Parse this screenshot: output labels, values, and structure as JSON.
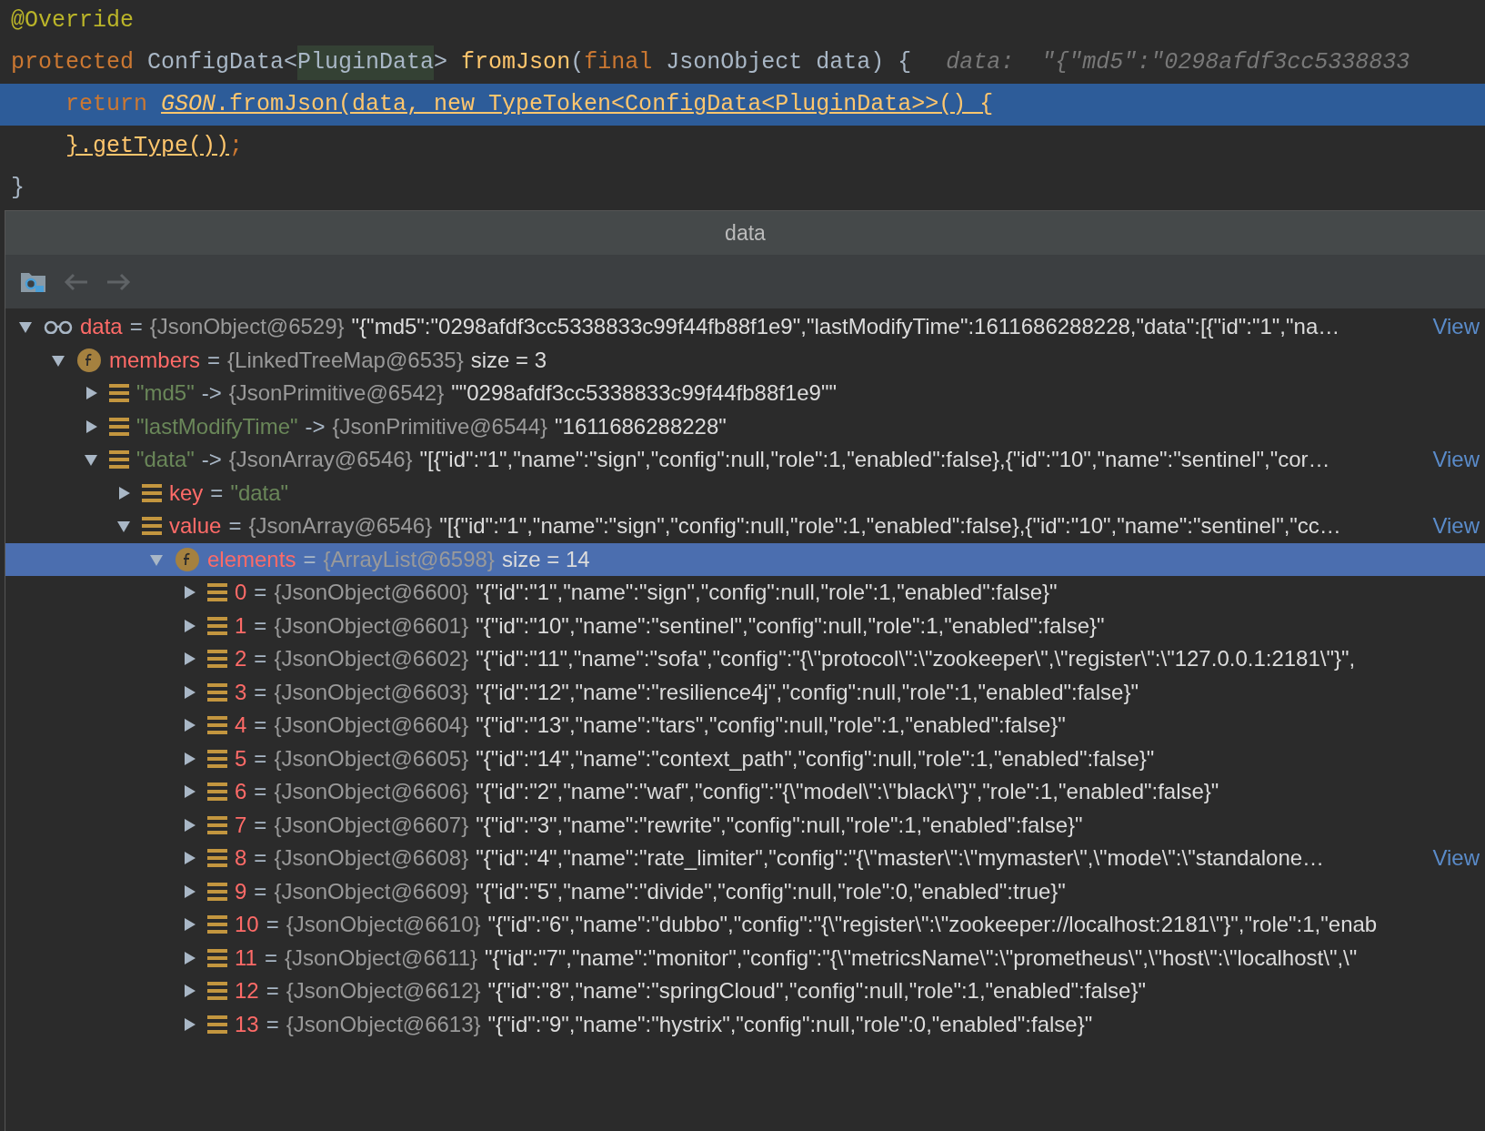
{
  "editor": {
    "lines": [
      {
        "kind": "top",
        "selected": false,
        "tokens": [
          {
            "kind": "annotation",
            "text": "@Override"
          }
        ]
      },
      {
        "kind": "top",
        "selected": false,
        "tokens": [
          {
            "kind": "keyword",
            "text": "protected"
          },
          {
            "kind": "plain",
            "text": " ConfigData<"
          },
          {
            "kind": "highlight",
            "text": "PluginData"
          },
          {
            "kind": "plain",
            "text": "> "
          },
          {
            "kind": "method",
            "text": "fromJson"
          },
          {
            "kind": "plain",
            "text": "("
          },
          {
            "kind": "keyword",
            "text": "final"
          },
          {
            "kind": "plain",
            "text": " JsonObject data) {"
          },
          {
            "kind": "hint",
            "text": "data:  \"{\"md5\":\"0298afdf3cc5338833"
          }
        ]
      },
      {
        "kind": "nested",
        "selected": true,
        "tokens": [
          {
            "kind": "keyword",
            "text": "return "
          },
          {
            "kind": "link_italic",
            "text": "GSON"
          },
          {
            "kind": "link",
            "text": ".fromJson(data, new TypeToken<ConfigData<PluginData>>() {"
          }
        ]
      },
      {
        "kind": "nested",
        "selected": false,
        "tokens": [
          {
            "kind": "link",
            "text": "}.getType())"
          },
          {
            "kind": "keyword",
            "text": ";"
          }
        ]
      },
      {
        "kind": "top",
        "selected": false,
        "tokens": [
          {
            "kind": "plain",
            "text": "}"
          }
        ]
      }
    ]
  },
  "popup": {
    "title": "data",
    "tree": [
      {
        "kind": "watch",
        "expanded": true,
        "selected": false,
        "name": "data",
        "operator": "=",
        "type": "{JsonObject@6529}",
        "value": "\"{\"md5\":\"0298afdf3cc5338833c99f44fb88f1e9\",\"lastModifyTime\":1611686288228,\"data\":[{\"id\":\"1\",\"na…",
        "link": "View",
        "children": [
          {
            "kind": "field",
            "expanded": true,
            "selected": false,
            "name": "members",
            "operator": "=",
            "type": "{LinkedTreeMap@6535}",
            "value": "size = 3",
            "children": [
              {
                "kind": "map_entry",
                "expanded": false,
                "selected": false,
                "name": "\"md5\"",
                "operator": "->",
                "type": "{JsonPrimitive@6542}",
                "value": "\"\"0298afdf3cc5338833c99f44fb88f1e9\"\""
              },
              {
                "kind": "map_entry",
                "expanded": false,
                "selected": false,
                "name": "\"lastModifyTime\"",
                "operator": "->",
                "type": "{JsonPrimitive@6544}",
                "value": "\"1611686288228\""
              },
              {
                "kind": "map_entry",
                "expanded": true,
                "selected": false,
                "name": "\"data\"",
                "operator": "->",
                "type": "{JsonArray@6546}",
                "value": "\"[{\"id\":\"1\",\"name\":\"sign\",\"config\":null,\"role\":1,\"enabled\":false},{\"id\":\"10\",\"name\":\"sentinel\",\"cor…",
                "link": "View",
                "children": [
                  {
                    "kind": "key",
                    "expanded": false,
                    "selected": false,
                    "name": "key",
                    "operator": "=",
                    "value": "\"data\""
                  },
                  {
                    "kind": "value",
                    "expanded": true,
                    "selected": false,
                    "name": "value",
                    "operator": "=",
                    "type": "{JsonArray@6546}",
                    "value": "\"[{\"id\":\"1\",\"name\":\"sign\",\"config\":null,\"role\":1,\"enabled\":false},{\"id\":\"10\",\"name\":\"sentinel\",\"cc…",
                    "link": "View",
                    "children": [
                      {
                        "kind": "field",
                        "expanded": true,
                        "selected": true,
                        "name": "elements",
                        "operator": "=",
                        "type": "{ArrayList@6598}",
                        "value": "size = 14",
                        "children": [
                          {
                            "kind": "element",
                            "expanded": false,
                            "selected": false,
                            "name": "0",
                            "operator": "=",
                            "type": "{JsonObject@6600}",
                            "value": "\"{\"id\":\"1\",\"name\":\"sign\",\"config\":null,\"role\":1,\"enabled\":false}\""
                          },
                          {
                            "kind": "element",
                            "expanded": false,
                            "selected": false,
                            "name": "1",
                            "operator": "=",
                            "type": "{JsonObject@6601}",
                            "value": "\"{\"id\":\"10\",\"name\":\"sentinel\",\"config\":null,\"role\":1,\"enabled\":false}\""
                          },
                          {
                            "kind": "element",
                            "expanded": false,
                            "selected": false,
                            "name": "2",
                            "operator": "=",
                            "type": "{JsonObject@6602}",
                            "value": "\"{\"id\":\"11\",\"name\":\"sofa\",\"config\":\"{\\\"protocol\\\":\\\"zookeeper\\\",\\\"register\\\":\\\"127.0.0.1:2181\\\"}\","
                          },
                          {
                            "kind": "element",
                            "expanded": false,
                            "selected": false,
                            "name": "3",
                            "operator": "=",
                            "type": "{JsonObject@6603}",
                            "value": "\"{\"id\":\"12\",\"name\":\"resilience4j\",\"config\":null,\"role\":1,\"enabled\":false}\""
                          },
                          {
                            "kind": "element",
                            "expanded": false,
                            "selected": false,
                            "name": "4",
                            "operator": "=",
                            "type": "{JsonObject@6604}",
                            "value": "\"{\"id\":\"13\",\"name\":\"tars\",\"config\":null,\"role\":1,\"enabled\":false}\""
                          },
                          {
                            "kind": "element",
                            "expanded": false,
                            "selected": false,
                            "name": "5",
                            "operator": "=",
                            "type": "{JsonObject@6605}",
                            "value": "\"{\"id\":\"14\",\"name\":\"context_path\",\"config\":null,\"role\":1,\"enabled\":false}\""
                          },
                          {
                            "kind": "element",
                            "expanded": false,
                            "selected": false,
                            "name": "6",
                            "operator": "=",
                            "type": "{JsonObject@6606}",
                            "value": "\"{\"id\":\"2\",\"name\":\"waf\",\"config\":\"{\\\"model\\\":\\\"black\\\"}\",\"role\":1,\"enabled\":false}\""
                          },
                          {
                            "kind": "element",
                            "expanded": false,
                            "selected": false,
                            "name": "7",
                            "operator": "=",
                            "type": "{JsonObject@6607}",
                            "value": "\"{\"id\":\"3\",\"name\":\"rewrite\",\"config\":null,\"role\":1,\"enabled\":false}\""
                          },
                          {
                            "kind": "element",
                            "expanded": false,
                            "selected": false,
                            "name": "8",
                            "operator": "=",
                            "type": "{JsonObject@6608}",
                            "value": "\"{\"id\":\"4\",\"name\":\"rate_limiter\",\"config\":\"{\\\"master\\\":\\\"mymaster\\\",\\\"mode\\\":\\\"standalone…",
                            "link": "View"
                          },
                          {
                            "kind": "element",
                            "expanded": false,
                            "selected": false,
                            "name": "9",
                            "operator": "=",
                            "type": "{JsonObject@6609}",
                            "value": "\"{\"id\":\"5\",\"name\":\"divide\",\"config\":null,\"role\":0,\"enabled\":true}\""
                          },
                          {
                            "kind": "element",
                            "expanded": false,
                            "selected": false,
                            "name": "10",
                            "operator": "=",
                            "type": "{JsonObject@6610}",
                            "value": "\"{\"id\":\"6\",\"name\":\"dubbo\",\"config\":\"{\\\"register\\\":\\\"zookeeper://localhost:2181\\\"}\",\"role\":1,\"enab"
                          },
                          {
                            "kind": "element",
                            "expanded": false,
                            "selected": false,
                            "name": "11",
                            "operator": "=",
                            "type": "{JsonObject@6611}",
                            "value": "\"{\"id\":\"7\",\"name\":\"monitor\",\"config\":\"{\\\"metricsName\\\":\\\"prometheus\\\",\\\"host\\\":\\\"localhost\\\",\\\""
                          },
                          {
                            "kind": "element",
                            "expanded": false,
                            "selected": false,
                            "name": "12",
                            "operator": "=",
                            "type": "{JsonObject@6612}",
                            "value": "\"{\"id\":\"8\",\"name\":\"springCloud\",\"config\":null,\"role\":1,\"enabled\":false}\""
                          },
                          {
                            "kind": "element",
                            "expanded": false,
                            "selected": false,
                            "name": "13",
                            "operator": "=",
                            "type": "{JsonObject@6613}",
                            "value": "\"{\"id\":\"9\",\"name\":\"hystrix\",\"config\":null,\"role\":0,\"enabled\":false}\""
                          }
                        ]
                      }
                    ]
                  }
                ]
              }
            ]
          }
        ]
      }
    ]
  }
}
